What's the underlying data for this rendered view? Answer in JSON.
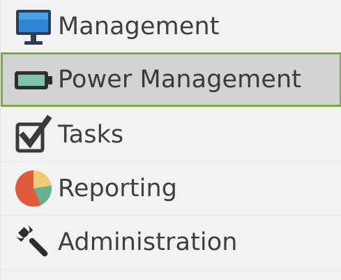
{
  "nav": {
    "items": [
      {
        "label": "Management",
        "icon": "monitor-icon",
        "selected": false
      },
      {
        "label": "Power Management",
        "icon": "battery-icon",
        "selected": true
      },
      {
        "label": "Tasks",
        "icon": "checkbox-icon",
        "selected": false
      },
      {
        "label": "Reporting",
        "icon": "pie-chart-icon",
        "selected": false
      },
      {
        "label": "Administration",
        "icon": "wrench-icon",
        "selected": false
      }
    ],
    "colors": {
      "selected_border": "#7bab43",
      "selected_background": "#d3d3d3",
      "background": "#f2f2f2",
      "text": "#3f3f3f"
    }
  }
}
